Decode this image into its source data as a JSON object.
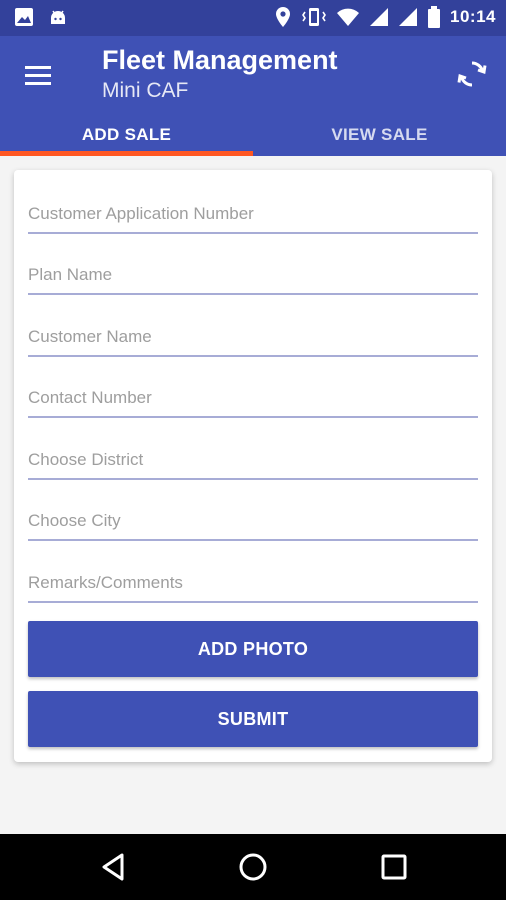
{
  "status_bar": {
    "time": "10:14",
    "left_icons": [
      "image-icon",
      "android-icon"
    ],
    "right_icons": [
      "location-icon",
      "vibrate-icon",
      "wifi-icon",
      "signal-icon",
      "signal-icon",
      "battery-icon"
    ]
  },
  "app_bar": {
    "title": "Fleet Management",
    "subtitle": "Mini CAF",
    "menu_icon": "menu-icon",
    "refresh_icon": "refresh-icon"
  },
  "tabs": [
    {
      "label": "ADD SALE",
      "active": true
    },
    {
      "label": "VIEW SALE",
      "active": false
    }
  ],
  "form": {
    "fields": [
      {
        "placeholder": "Customer Application Number",
        "value": ""
      },
      {
        "placeholder": "Plan Name",
        "value": ""
      },
      {
        "placeholder": "Customer Name",
        "value": ""
      },
      {
        "placeholder": "Contact Number",
        "value": ""
      },
      {
        "placeholder": "Choose District",
        "value": ""
      },
      {
        "placeholder": "Choose City",
        "value": ""
      },
      {
        "placeholder": "Remarks/Comments",
        "value": ""
      }
    ],
    "add_photo_label": "ADD PHOTO",
    "submit_label": "SUBMIT"
  },
  "colors": {
    "primary": "#3f51b5",
    "primary_dark": "#33419b",
    "accent": "#ff5722",
    "underline": "#a7acd6",
    "placeholder": "#9e9e9e"
  },
  "nav_bar": {
    "buttons": [
      "back-icon",
      "home-icon",
      "recents-icon"
    ]
  }
}
